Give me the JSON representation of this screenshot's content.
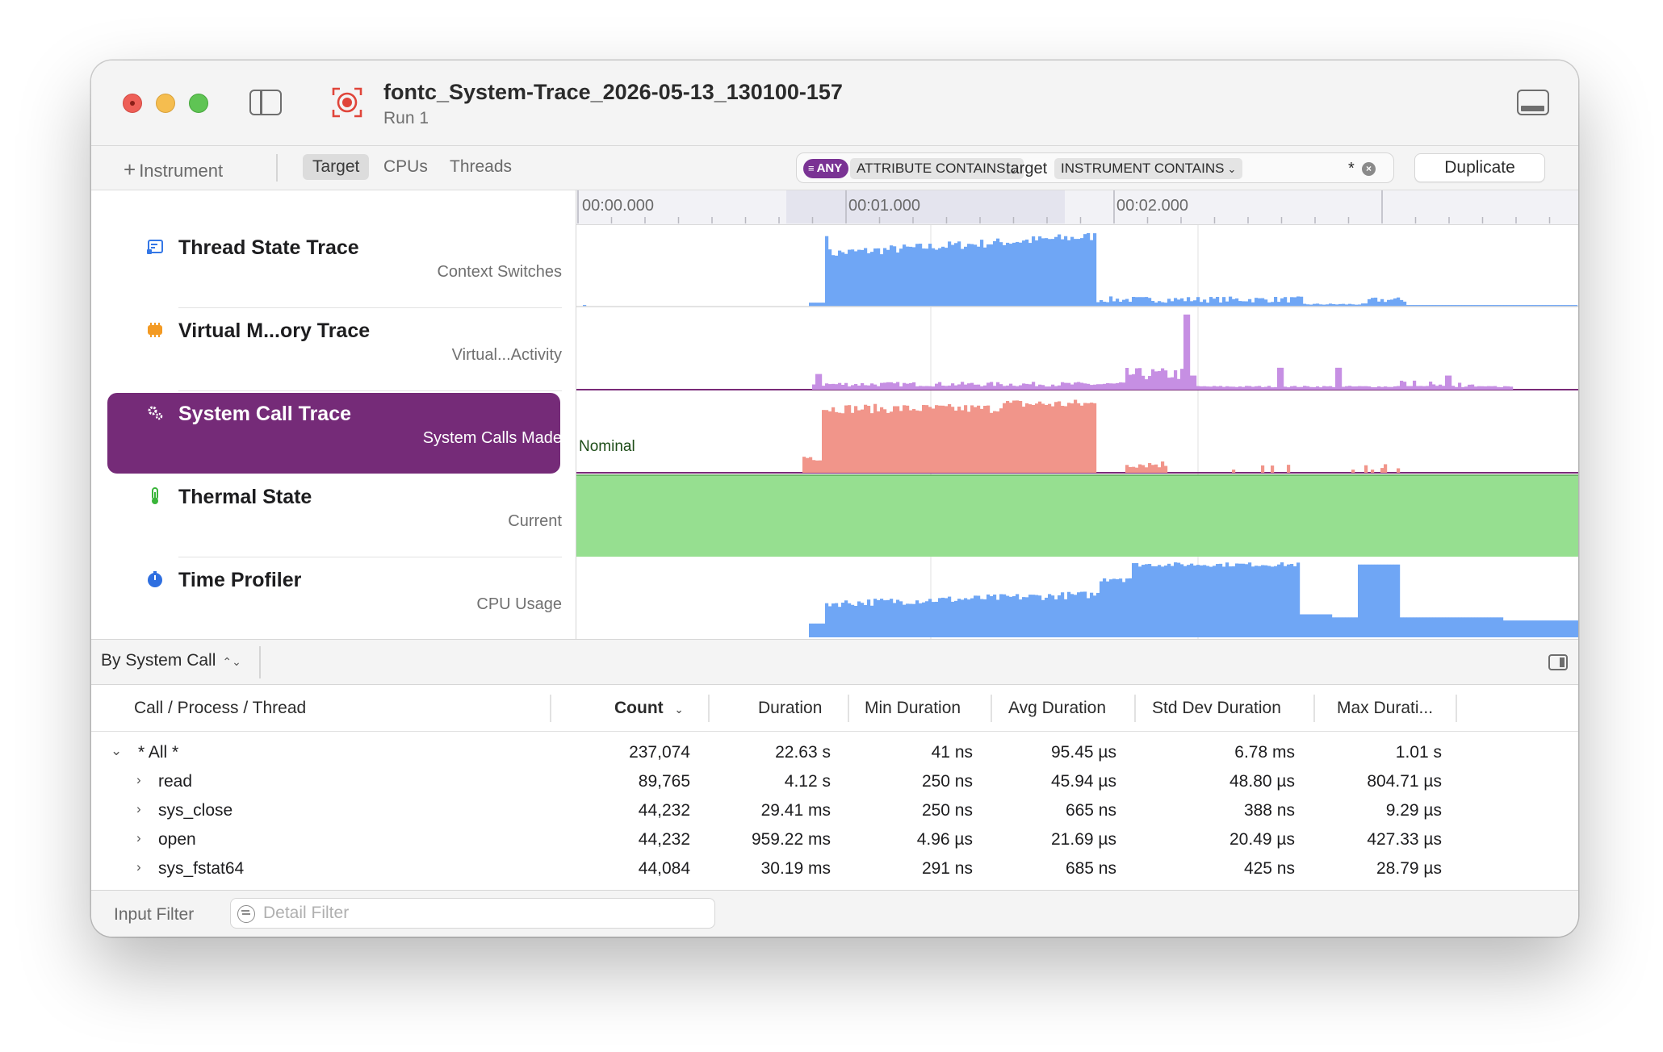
{
  "window": {
    "title": "fontc_System-Trace_2026-05-13_130100-157",
    "subtitle": "Run 1"
  },
  "toolbar": {
    "add_instrument": "Instrument",
    "tabs": [
      "Target",
      "CPUs",
      "Threads"
    ],
    "active_tab": "Target",
    "filter": {
      "any_label": "ANY",
      "token1": "ATTRIBUTE CONTAINS",
      "token1_value": "target",
      "token2": "INSTRUMENT CONTAINS",
      "token2_value": "*"
    },
    "duplicate_label": "Duplicate"
  },
  "ruler": {
    "labels": [
      "00:00.000",
      "00:01.000",
      "00:02.000"
    ]
  },
  "tracks": [
    {
      "name": "Thread State Trace",
      "subtitle": "Context Switches",
      "icon": "thread-state-icon",
      "color": "#6fa6f5"
    },
    {
      "name": "Virtual M...ory Trace",
      "subtitle": "Virtual...Activity",
      "icon": "memory-chip-icon",
      "color": "#c68fe3"
    },
    {
      "name": "System Call Trace",
      "subtitle": "System Calls Made",
      "icon": "gears-icon",
      "color": "#f1958a",
      "selected": true
    },
    {
      "name": "Thermal State",
      "subtitle": "Current",
      "icon": "thermometer-icon",
      "color": "#96df90",
      "graph_label": "Nominal"
    },
    {
      "name": "Time Profiler",
      "subtitle": "CPU Usage",
      "icon": "stopwatch-icon",
      "color": "#6fa6f5"
    }
  ],
  "detail": {
    "view_selector": "By System Call",
    "columns": [
      "Call / Process / Thread",
      "Count",
      "Duration",
      "Min Duration",
      "Avg Duration",
      "Std Dev Duration",
      "Max Durati..."
    ],
    "sorted_column": "Count",
    "rows": [
      {
        "name": "* All *",
        "expanded": true,
        "count": "237,074",
        "duration": "22.63 s",
        "min": "41 ns",
        "avg": "95.45 µs",
        "std": "6.78 ms",
        "max": "1.01 s"
      },
      {
        "name": "read",
        "count": "89,765",
        "duration": "4.12 s",
        "min": "250 ns",
        "avg": "45.94 µs",
        "std": "48.80 µs",
        "max": "804.71 µs"
      },
      {
        "name": "sys_close",
        "count": "44,232",
        "duration": "29.41 ms",
        "min": "250 ns",
        "avg": "665 ns",
        "std": "388 ns",
        "max": "9.29 µs"
      },
      {
        "name": "open",
        "count": "44,232",
        "duration": "959.22 ms",
        "min": "4.96 µs",
        "avg": "21.69 µs",
        "std": "20.49 µs",
        "max": "427.33 µs"
      },
      {
        "name": "sys_fstat64",
        "count": "44,084",
        "duration": "30.19 ms",
        "min": "291 ns",
        "avg": "685 ns",
        "std": "425 ns",
        "max": "28.79 µs"
      }
    ]
  },
  "footer": {
    "input_filter_label": "Input Filter",
    "detail_filter_placeholder": "Detail Filter"
  }
}
